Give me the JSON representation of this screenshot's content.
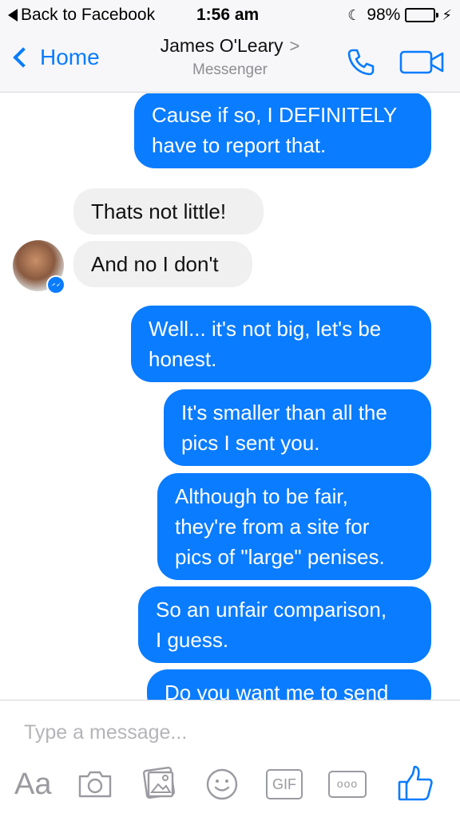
{
  "status_bar": {
    "back_label": "Back to Facebook",
    "time": "1:56 am",
    "battery": "98%",
    "battery_level": 0.98
  },
  "nav": {
    "back_label": "Home",
    "contact_name": "James O'Leary",
    "subtitle": "Messenger",
    "call_icon": "phone-icon",
    "video_icon": "video-camera-icon"
  },
  "messages": [
    {
      "direction": "outgoing",
      "lines": [
        "Cause if so, I DEFINITELY",
        "have to report that."
      ]
    },
    {
      "direction": "incoming",
      "lines": [
        "Thats not little!"
      ]
    },
    {
      "direction": "incoming",
      "lines": [
        "And no I don't"
      ]
    },
    {
      "direction": "outgoing",
      "lines": [
        "Well... it's not big, let's be",
        "honest."
      ]
    },
    {
      "direction": "outgoing",
      "lines": [
        "It's smaller than all the",
        "pics I sent you."
      ]
    },
    {
      "direction": "outgoing",
      "lines": [
        "Although to be fair,",
        "they're from a site for",
        "pics of \"large\" penises."
      ]
    },
    {
      "direction": "outgoing",
      "lines": [
        "So an unfair comparison,",
        "I guess."
      ]
    },
    {
      "direction": "outgoing",
      "lines": [
        "Do you want me to send"
      ]
    }
  ],
  "composer": {
    "placeholder": "Type a message...",
    "aa_label": "Aa",
    "gif_label": "GIF",
    "more_label": "ooo",
    "tools": [
      "text-format-icon",
      "camera-icon",
      "gallery-icon",
      "emoji-icon",
      "gif-icon",
      "more-icon",
      "like-icon"
    ]
  },
  "colors": {
    "accent": "#0a7cff",
    "outgoing_bubble": "#0a7cff",
    "incoming_bubble": "#f0f0f0",
    "battery": "#4cd964"
  }
}
